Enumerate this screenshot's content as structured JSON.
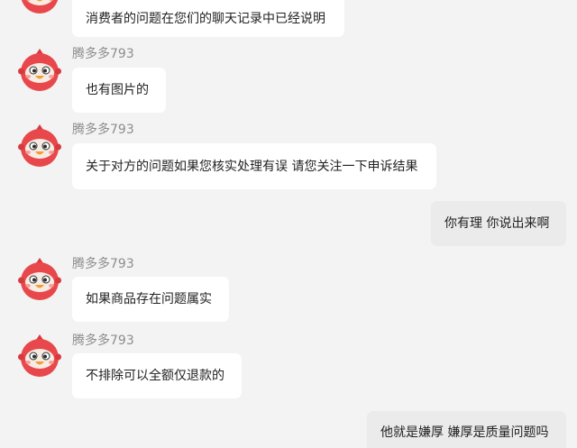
{
  "messages": [
    {
      "side": "other",
      "sender": "",
      "text": "消费者的问题在您们的聊天记录中已经说明"
    },
    {
      "side": "other",
      "sender": "腾多多793",
      "text": "也有图片的"
    },
    {
      "side": "other",
      "sender": "腾多多793",
      "text": "关于对方的问题如果您核实处理有误 请您关注一下申诉结果"
    },
    {
      "side": "self",
      "sender": "",
      "text": "你有理 你说出来啊"
    },
    {
      "side": "other",
      "sender": "腾多多793",
      "text": "如果商品存在问题属实"
    },
    {
      "side": "other",
      "sender": "腾多多793",
      "text": "不排除可以全额仅退款的"
    },
    {
      "side": "self",
      "sender": "",
      "text": "他就是嫌厚 嫌厚是质量问题吗"
    }
  ],
  "colors": {
    "background": "#f3f3f3",
    "other_bubble": "#ffffff",
    "self_bubble": "#ebebeb",
    "avatar_red": "#e8484b"
  },
  "avatar_icon": "red-bird-mascot-icon"
}
